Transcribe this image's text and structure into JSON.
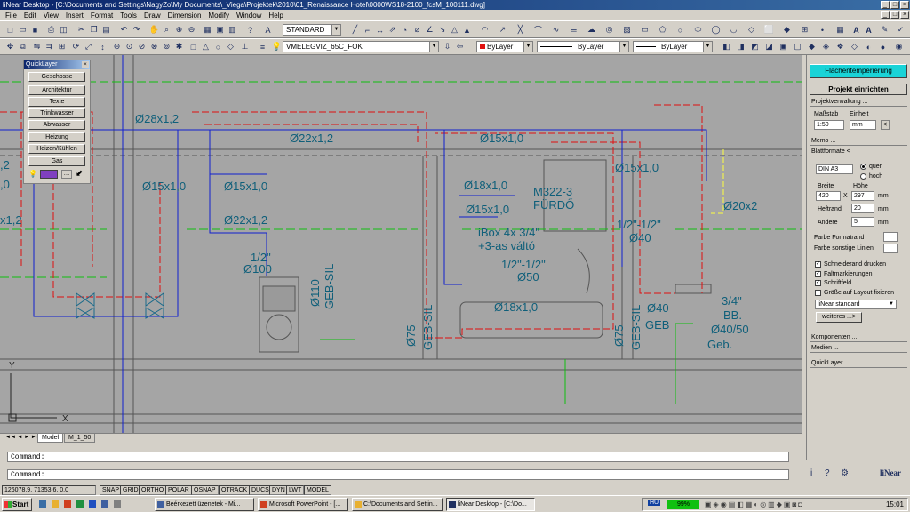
{
  "window": {
    "title": "liNear Desktop - [C:\\Documents and Settings\\NagyZo\\My Documents\\_Viega\\Projektek\\2010\\01_Renaissance Hotel\\0000WS18-2100_fcsM_100111.dwg]"
  },
  "menu": {
    "items": [
      "File",
      "Edit",
      "View",
      "Insert",
      "Format",
      "Tools",
      "Draw",
      "Dimension",
      "Modify",
      "Window",
      "Help"
    ]
  },
  "toolbar": {
    "text_style": "STANDARD",
    "layer": "VMELEGVIZ_65C_FOK",
    "color": "ByLayer",
    "linetype": "ByLayer",
    "lineweight": "ByLayer"
  },
  "quicklayer": {
    "title": "QuickLayer",
    "buttons": [
      "Geschosse",
      "Architektur",
      "Texte",
      "Trinkwasser",
      "Abwasser",
      "Heizung",
      "Heizen/Kühlen",
      "Gas"
    ]
  },
  "drawing": {
    "labels": {
      "d28x12": "Ø28x1,2",
      "d22x12_top": "Ø22x1,2",
      "d15x10_top": "Ø15x1,0",
      "d15x10_right": "Ø15x1,0",
      "d12_left": ",2",
      "d10_left": ",0",
      "d15x10_a": "Ø15x1,0",
      "d15x10_b": "Ø15x1,0",
      "d18x10": "Ø18x1,0",
      "d15x10_c": "Ø15x1,0",
      "d22x12_mid": "Ø22x1,2",
      "x12_left": "x1,2",
      "room_code": "M322-3",
      "room_name": "FÜRDŐ",
      "d20x2": "Ø20x2",
      "ibox1": "iBox 4x 3/4\"",
      "ibox2": "+3-as váltó",
      "half_in": "1/2\"",
      "d100": "Ø100",
      "d110": "Ø110",
      "gebsil1": "GEB-SIL",
      "half_half_a": "1/2\"-1/2\"",
      "d50": "Ø50",
      "half_half_b": "1/2\"-1/2\"",
      "d40a": "Ø40",
      "d18x10_b": "Ø18x1,0",
      "d75a": "Ø75",
      "gebsil2": "GEB-SIL",
      "d75b": "Ø75",
      "gebsil3": "GEB-SIL",
      "three_q": "3/4\"",
      "bb": "BB.",
      "d40b": "Ø40",
      "geb": "GEB",
      "d4050": "Ø40/50",
      "gebp": "Geb.",
      "axis_y": "Y",
      "axis_x": "X"
    }
  },
  "tabs": [
    "Model",
    "M_1_50"
  ],
  "command": {
    "line1": "Command:",
    "line2": "Command:"
  },
  "status": {
    "coords": "126078.9, 71353.6, 0.0",
    "toggles": [
      "SNAP",
      "GRID",
      "ORTHO",
      "POLAR",
      "OSNAP",
      "OTRACK",
      "DUCS",
      "DYN",
      "LWT",
      "MODEL"
    ]
  },
  "panel": {
    "top_button": "Flächentemperierung",
    "projekt_button": "Projekt einrichten",
    "sections": {
      "projektverwaltung": "Projektverwaltung ...",
      "memo": "Memo ...",
      "blattformate": "Blattformate <",
      "komponenten": "Komponenten ...",
      "medien": "Medien ...",
      "quicklayer": "QuickLayer ..."
    },
    "massstab_label": "Maßstab",
    "einheit_label": "Einheit",
    "massstab_value": "1:50",
    "einheit_value": "mm",
    "format_value": "DIN A3",
    "quer_label": "quer",
    "hoch_label": "hoch",
    "breite_label": "Breite",
    "hoehe_label": "Höhe",
    "breite_value": "420",
    "x_label": "X",
    "hoehe_value": "297",
    "mm1": "mm",
    "heftrand_label": "Heftrand",
    "heftrand_value": "20",
    "mm2": "mm",
    "andere_label": "Andere",
    "andere_value": "5",
    "mm3": "mm",
    "farbe_formatrand": "Farbe Formatrand",
    "farbe_sonstige": "Farbe sonstige Linien",
    "chk_schneiderand": "Schneiderand drucken",
    "chk_faltmarkierungen": "Faltmarkierungen",
    "chk_schriftfeld": "Schriftfeld",
    "chk_groesse": "Größe auf Layout fixieren",
    "standard_select": "liNear standard",
    "weiteres": "weiteres ...>",
    "logo": "liNear"
  },
  "taskbar": {
    "start": "Start",
    "tasks": [
      "Beérkezett üzenetek - Mi...",
      "Microsoft PowerPoint - [...",
      "C:\\Documents and Settin...",
      "liNear Desktop - [C:\\Do..."
    ],
    "lang": "HU",
    "battery": "99%",
    "clock": "15:01"
  },
  "colors": {
    "canvas_bg": "#a5a5a5",
    "red_pipe": "#e01010",
    "blue_pipe": "#1020d0",
    "cyan_text": "#0f5f7a",
    "green_line": "#10c010",
    "panel_accent": "#19d3d7"
  }
}
